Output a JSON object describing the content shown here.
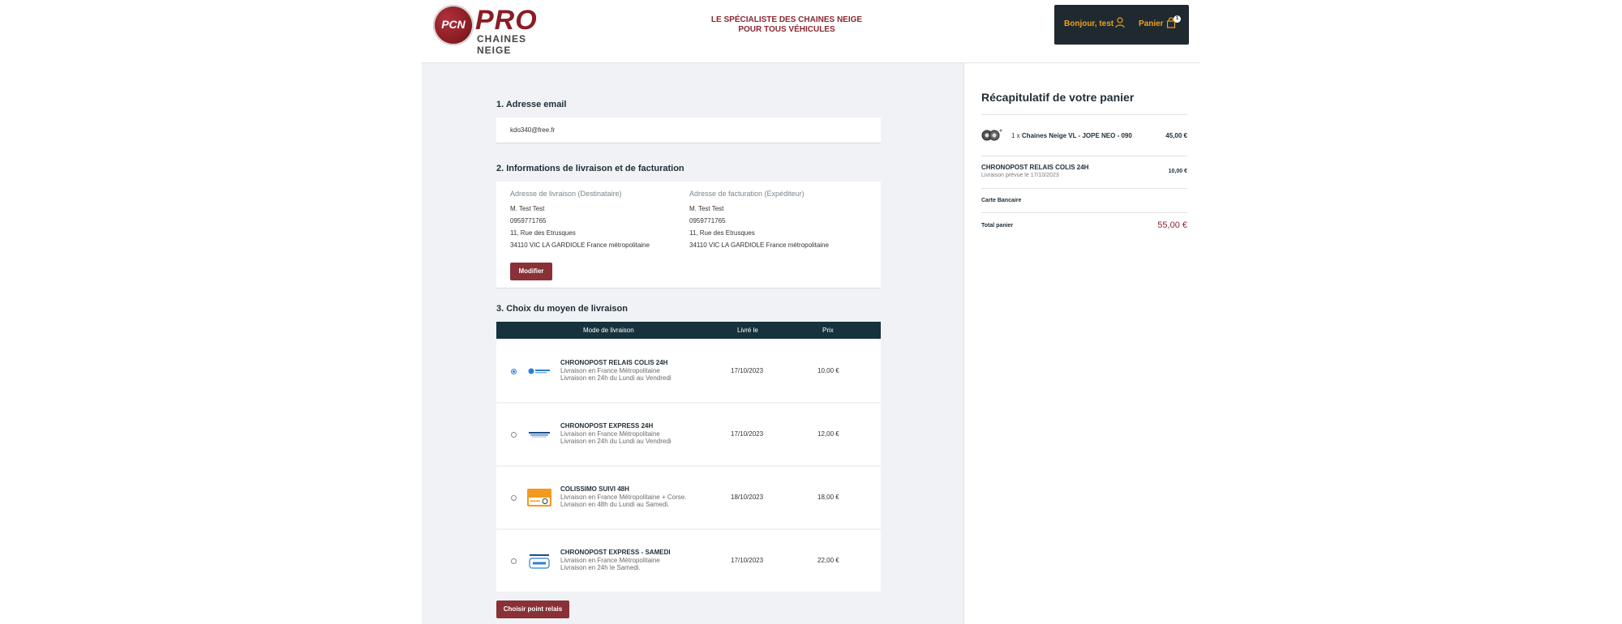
{
  "header": {
    "logo_brand": "PRO",
    "logo_sub": "CHAINES NEIGE",
    "logo_emblem": "PCN",
    "tagline_line1": "LE SPÉCIALISTE DES CHAINES NEIGE",
    "tagline_line2": "POUR TOUS VÉHICULES",
    "greeting": "Bonjour, test",
    "cart_label": "Panier",
    "cart_count": "1"
  },
  "sections": {
    "email_title": "1. Adresse email",
    "shipping_info_title": "2. Informations de livraison et de facturation",
    "delivery_choice_title": "3. Choix du moyen de livraison"
  },
  "email": {
    "value": "kdo340@free.fr"
  },
  "addresses": {
    "shipping": {
      "heading": "Adresse de livraison (Destinataire)",
      "name": "M. Test Test",
      "phone": "0959771765",
      "street": "11, Rue des Etrusques",
      "city": "34110 VIC LA GARDIOLE France métropolitaine"
    },
    "billing": {
      "heading": "Adresse de facturation (Expéditeur)",
      "name": "M. Test Test",
      "phone": "0959771765",
      "street": "11, Rue des Etrusques",
      "city": "34110 VIC LA GARDIOLE France métropolitaine"
    },
    "modify_label": "Modifier"
  },
  "shipping_table": {
    "col_mode": "Mode de livraison",
    "col_date": "Livré le",
    "col_price": "Prix",
    "rows": [
      {
        "name": "CHRONOPOST RELAIS COLIS 24H",
        "desc1": "Livraison en France Métropolitaine",
        "desc2": "Livraison en 24h du Lundi au Vendredi",
        "date": "17/10/2023",
        "price": "10,00 €",
        "logo": "chronopost-logo",
        "selected": true
      },
      {
        "name": "CHRONOPOST EXPRESS 24H",
        "desc1": "Livraison en France Métropolitaine",
        "desc2": "Livraison en 24h du Lundi au Vendredi",
        "date": "17/10/2023",
        "price": "12,00 €",
        "logo": "chronopost-express-logo",
        "selected": false
      },
      {
        "name": "COLISSIMO SUIVI 48H",
        "desc1": "Livraison en France Métropolitaine + Corse.",
        "desc2": "Livraison en 48h du Lundi au Samedi.",
        "date": "18/10/2023",
        "price": "18,00 €",
        "logo": "colissimo-logo",
        "selected": false
      },
      {
        "name": "CHRONOPOST EXPRESS - SAMEDI",
        "desc1": "Livraison en France Métropolitaine",
        "desc2": "Livraison en 24h le Samedi.",
        "date": "17/10/2023",
        "price": "22,00 €",
        "logo": "chronopost-samedi-logo",
        "selected": false
      }
    ],
    "relay_button": "Choisir point relais"
  },
  "summary": {
    "title": "Récapitulatif de votre panier",
    "product_qty": "1 x",
    "product_name": "Chaines Neige VL - JOPE NEO - 090",
    "product_price": "45,00 €",
    "shipping_name": "CHRONOPOST RELAIS COLIS 24H",
    "shipping_date": "Livraison prévue le 17/10/2023",
    "shipping_price": "10,00 €",
    "payment_method": "Carte Bancaire",
    "total_label": "Total panier",
    "total_value": "55,00 €"
  },
  "colors": {
    "brand_red": "#8a3037",
    "header_dark": "#1f2a30",
    "table_header": "#15323d",
    "accent_orange": "#f0a020"
  }
}
